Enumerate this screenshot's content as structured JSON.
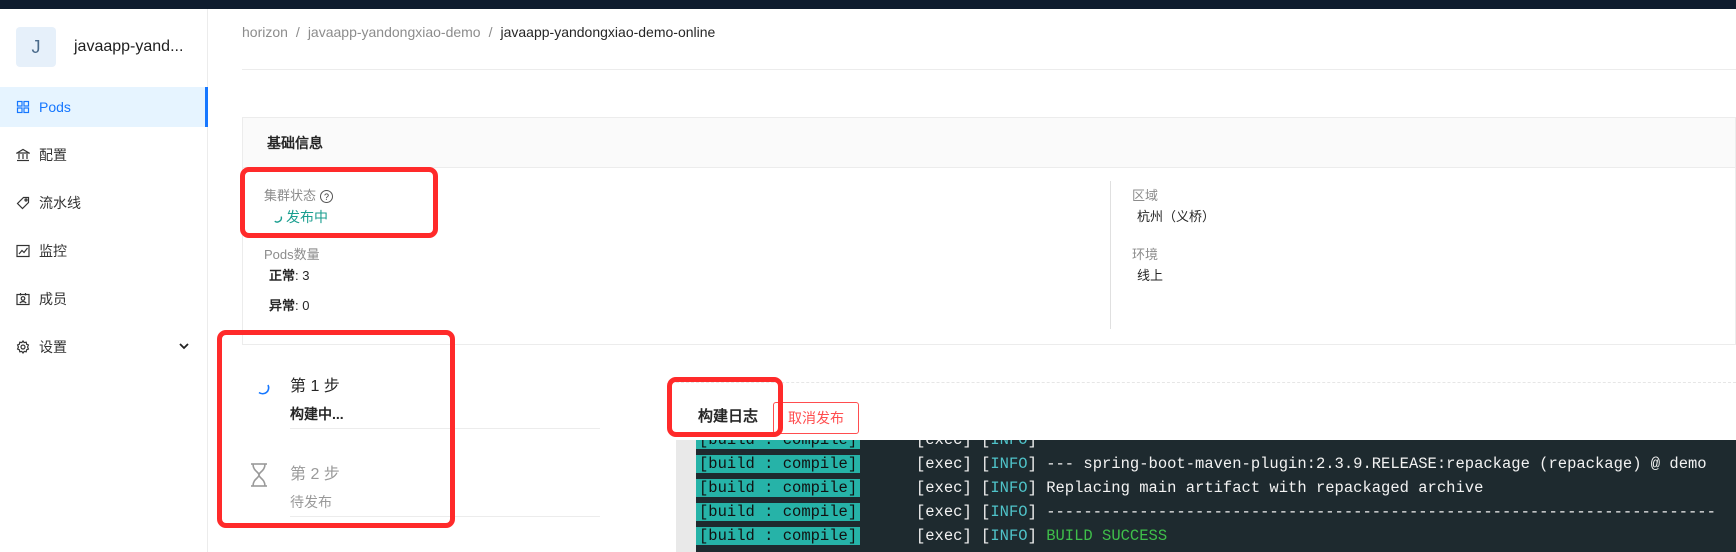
{
  "app": {
    "avatar_letter": "J",
    "name": "javaapp-yand..."
  },
  "sidebar": {
    "items": [
      {
        "label": "Pods",
        "icon": "grid-icon",
        "active": true
      },
      {
        "label": "配置",
        "icon": "bank-icon"
      },
      {
        "label": "流水线",
        "icon": "tag-icon"
      },
      {
        "label": "监控",
        "icon": "chart-icon"
      },
      {
        "label": "成员",
        "icon": "member-card-icon"
      },
      {
        "label": "设置",
        "icon": "gear-icon",
        "has_submenu": true
      }
    ]
  },
  "breadcrumb": {
    "items": [
      "horizon",
      "javaapp-yandongxiao-demo",
      "javaapp-yandongxiao-demo-online"
    ],
    "separator": "/"
  },
  "basic_info": {
    "title": "基础信息",
    "cluster_status_label": "集群状态",
    "help_icon": "?",
    "cluster_status_value": "发布中",
    "pods_label": "Pods数量",
    "normal_label": "正常",
    "normal_value": ": 3",
    "abnormal_label": "异常",
    "abnormal_value": ": 0",
    "region_label": "区域",
    "region_value": "杭州（义桥）",
    "env_label": "环境",
    "env_value": "线上"
  },
  "steps": [
    {
      "title": "第 1 步",
      "status": "构建中...",
      "state": "running"
    },
    {
      "title": "第 2 步",
      "status": "待发布",
      "state": "waiting"
    }
  ],
  "build_log": {
    "title": "构建日志",
    "cancel_label": "取消发布",
    "lines": [
      {
        "tag": "[build : compile]",
        "exec": "      [exec] [",
        "level": "INFO",
        "msg": "]"
      },
      {
        "tag": "[build : compile]",
        "exec": "      [exec] [",
        "level": "INFO",
        "msg": "] --- spring-boot-maven-plugin:2.3.9.RELEASE:repackage (repackage) @ demo"
      },
      {
        "tag": "[build : compile]",
        "exec": "      [exec] [",
        "level": "INFO",
        "msg": "] Replacing main artifact with repackaged archive"
      },
      {
        "tag": "[build : compile]",
        "exec": "      [exec] [",
        "level": "INFO",
        "msg": "] ------------------------------------------------------------------------"
      },
      {
        "tag": "[build : compile]",
        "exec": "      [exec] [",
        "level": "INFO",
        "msg": "] ",
        "success": "BUILD SUCCESS"
      }
    ]
  },
  "colors": {
    "accent": "#1677ff",
    "status": "#1a9e8f",
    "danger": "#ff4d4f",
    "terminal_bg": "#1e2a2f",
    "annotation": "#ff2a2a"
  }
}
